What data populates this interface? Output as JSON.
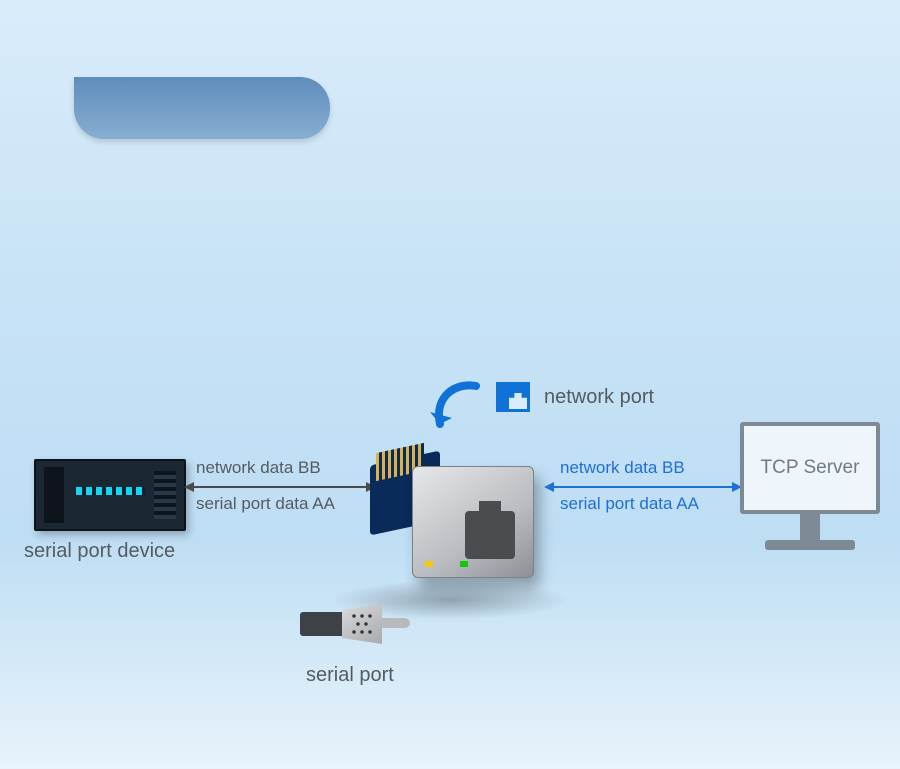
{
  "labels": {
    "network_port": "network port",
    "serial_port": "serial port",
    "serial_port_device": "serial port device",
    "tcp_server": "TCP Server"
  },
  "left_flow": {
    "top": "network data BB",
    "bottom": "serial port data AA"
  },
  "right_flow": {
    "top": "network data BB",
    "bottom": "serial port data AA"
  }
}
